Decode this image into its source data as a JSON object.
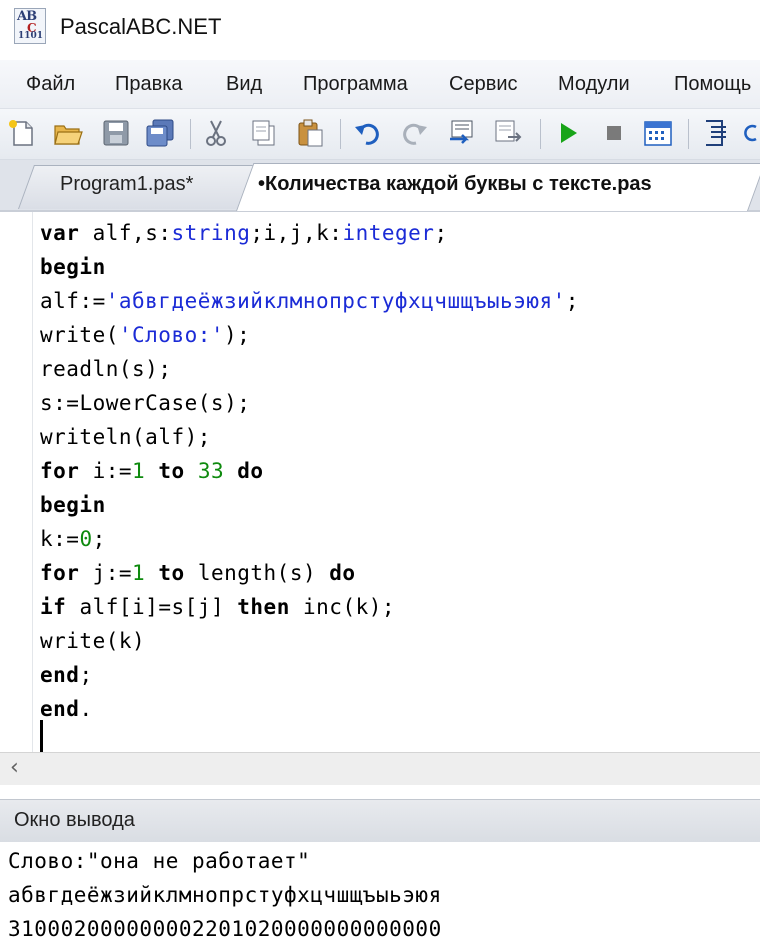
{
  "window": {
    "title": "PascalABC.NET",
    "icon_text_top": "AB",
    "icon_text_mid": "C",
    "icon_text_bottom": "1101"
  },
  "menu": [
    "Файл",
    "Правка",
    "Вид",
    "Программа",
    "Сервис",
    "Модули",
    "Помощь"
  ],
  "toolbar": {
    "buttons": [
      "new-file-icon",
      "open-folder-icon",
      "save-icon",
      "save-all-icon",
      "cut-icon",
      "copy-icon",
      "paste-icon",
      "undo-icon",
      "redo-icon",
      "compile-icon",
      "debug-step-icon",
      "run-icon",
      "stop-icon",
      "form-designer-icon",
      "output-panel-icon",
      "refresh-icon"
    ],
    "colors": {
      "run": "#18a418",
      "undo": "#1f5fbf",
      "stop": "#7a7a7a"
    }
  },
  "tabs": [
    {
      "label": "Program1.pas*",
      "active": false
    },
    {
      "label": "•Количества каждой буквы с тексте.pas",
      "active": true
    }
  ],
  "editor": {
    "lines": [
      "var alf,s:string;i,j,k:integer;",
      "begin",
      "alf:='абвгдеёжзийклмнопрстуфхцчшщъыьэюя';",
      "write('Слово:');",
      "readln(s);",
      "s:=LowerCase(s);",
      "writeln(alf);",
      "for i:=1 to 33 do",
      "begin",
      "k:=0;",
      "for j:=1 to length(s) do",
      "if alf[i]=s[j] then inc(k);",
      "write(k)",
      "end;",
      "end."
    ],
    "colors": {
      "keyword": "#000000",
      "type_and_string": "#1b2bd6",
      "number": "#0e8a0e"
    }
  },
  "output_panel": {
    "title": "Окно вывода",
    "lines": [
      "Слово:\"она не работает\"",
      "абвгдеёжзийклмнопрстуфхцчшщъыьэюя",
      "310002000000002201020000000000000"
    ]
  }
}
